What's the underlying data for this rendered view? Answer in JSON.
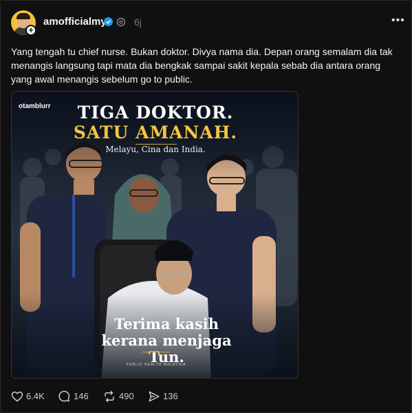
{
  "post": {
    "username": "amofficialmy",
    "time": "6j",
    "more_label": "•••",
    "caption": "Yang tengah tu chief nurse. Bukan doktor. Divya nama dia. Depan orang semalam dia tak menangis langsung tapi mata dia bengkak sampai sakit kepala sebab dia antara orang yang awal menangis sebelum go to public.",
    "icons": {
      "verified": "verified-badge-icon",
      "threads": "threads-logo-icon",
      "follow": "plus-icon"
    }
  },
  "media": {
    "brand": "otamblurr",
    "headline_1": "TIGA DOKTOR.",
    "headline_2": "SATU AMANAH.",
    "subtitle": "Melayu, Cina dan India.",
    "thanks_1": "Terima kasih",
    "thanks_2": "kerana menjaga Tun.",
    "footer": "PUBLIC HEALTH MALAYSIA",
    "colors": {
      "headline_accent": "#f4c542",
      "scrubs": "#1f2740"
    }
  },
  "actions": {
    "likes": "6.4K",
    "comments": "146",
    "reposts": "490",
    "shares": "136"
  }
}
